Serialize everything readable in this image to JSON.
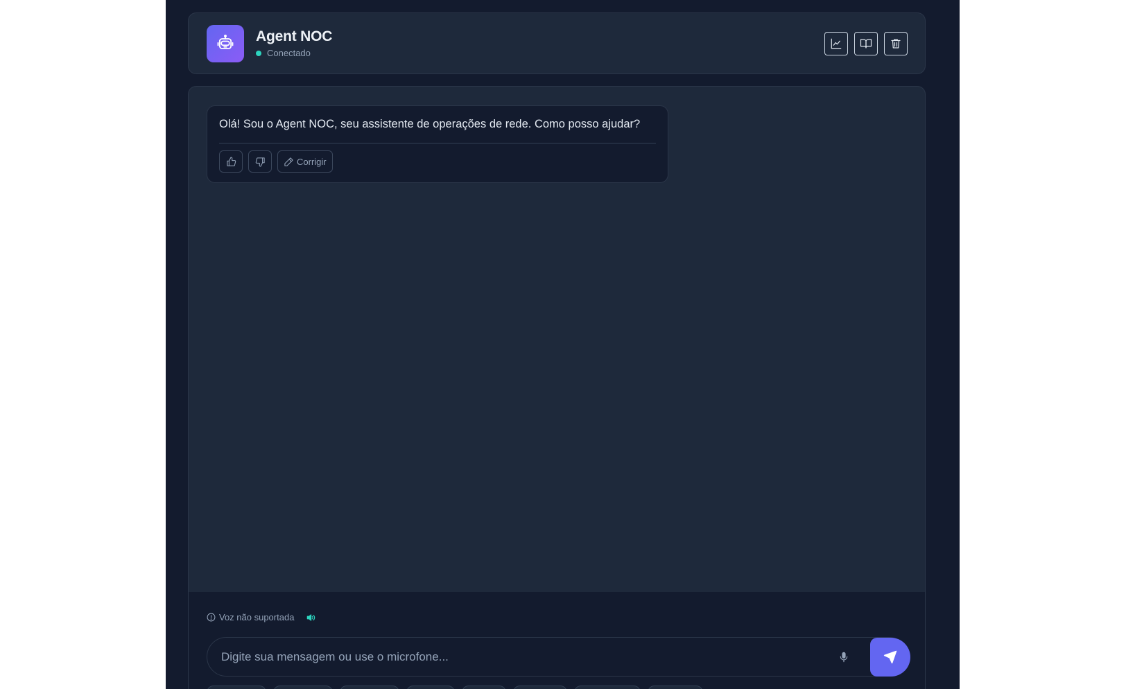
{
  "header": {
    "title": "Agent NOC",
    "status": "Conectado",
    "actions": [
      {
        "name": "analytics",
        "icon": "line-chart-icon"
      },
      {
        "name": "knowledge",
        "icon": "book-icon"
      },
      {
        "name": "clear",
        "icon": "trash-icon"
      }
    ]
  },
  "messages": [
    {
      "role": "assistant",
      "text": "Olá! Sou o Agent NOC, seu assistente de operações de rede. Como posso ajudar?",
      "feedback": {
        "correct_label": "Corrigir"
      }
    }
  ],
  "composer": {
    "voice_status": "Voz não suportada",
    "placeholder": "Digite sua mensagem ou use o microfone..."
  },
  "colors": {
    "background": "#131b2e",
    "panel": "#1e293b",
    "accent": "#6366f1",
    "status_online": "#2dd4bf"
  }
}
